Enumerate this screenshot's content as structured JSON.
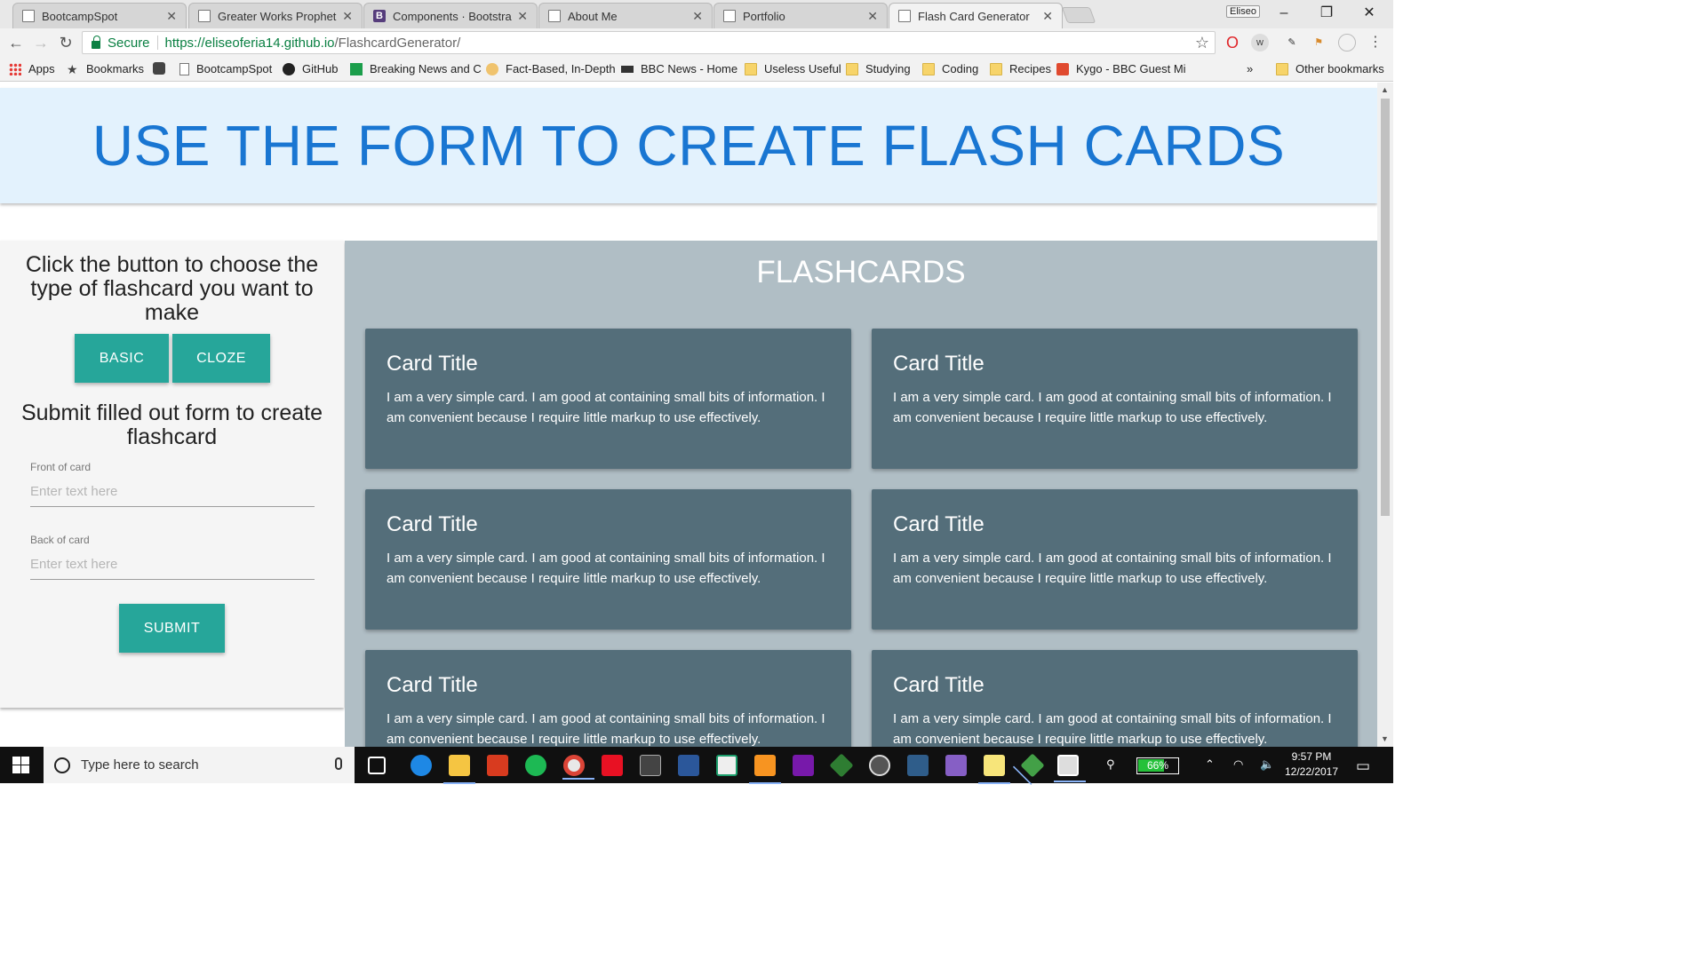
{
  "browser": {
    "tabs": [
      {
        "title": "BootcampSpot",
        "icon": "doc-icon"
      },
      {
        "title": "Greater Works Prophetic",
        "icon": "doc-icon"
      },
      {
        "title": "Components · Bootstrap",
        "icon": "bootstrap-icon"
      },
      {
        "title": "About Me",
        "icon": "doc-icon"
      },
      {
        "title": "Portfolio",
        "icon": "doc-icon"
      },
      {
        "title": "Flash Card Generator",
        "icon": "doc-icon",
        "active": true
      }
    ],
    "profile_name": "Eliseo",
    "address": {
      "secure_label": "Secure",
      "url_scheme_host": "https://eliseoferia14.github.io",
      "url_path": "/FlashcardGenerator/"
    },
    "bookmarks": [
      {
        "label": "Apps",
        "icon": "apps-icon"
      },
      {
        "label": "Bookmarks",
        "icon": "star-icon"
      },
      {
        "label": "",
        "icon": "sneaker-icon"
      },
      {
        "label": "BootcampSpot",
        "icon": "doc-icon"
      },
      {
        "label": "GitHub",
        "icon": "github-icon"
      },
      {
        "label": "Breaking News and C",
        "icon": "news-icon"
      },
      {
        "label": "Fact-Based, In-Depth",
        "icon": "flame-icon"
      },
      {
        "label": "BBC News - Home",
        "icon": "bbc-icon"
      },
      {
        "label": "Useless Useful",
        "icon": "folder-icon"
      },
      {
        "label": "Studying",
        "icon": "folder-icon"
      },
      {
        "label": "Coding",
        "icon": "folder-icon"
      },
      {
        "label": "Recipes",
        "icon": "folder-icon"
      },
      {
        "label": "Kygo - BBC Guest Mi",
        "icon": "soundcloud-icon"
      }
    ],
    "overflow_label": "»",
    "other_bookmarks": "Other bookmarks"
  },
  "page": {
    "header": "USE THE FORM TO CREATE FLASH CARDS",
    "left": {
      "instruction": "Click the button to choose the type of flashcard you want to make",
      "basic_button": "BASIC",
      "cloze_button": "CLOZE",
      "submit_instruction": "Submit filled out form to create flashcard",
      "front_label": "Front of card",
      "front_placeholder": "Enter text here",
      "back_label": "Back of card",
      "back_placeholder": "Enter text here",
      "submit_button": "SUBMIT"
    },
    "right": {
      "heading": "FLASHCARDS",
      "cards": [
        {
          "title": "Card Title",
          "body": "I am a very simple card. I am good at containing small bits of information. I am convenient because I require little markup to use effectively."
        },
        {
          "title": "Card Title",
          "body": "I am a very simple card. I am good at containing small bits of information. I am convenient because I require little markup to use effectively."
        },
        {
          "title": "Card Title",
          "body": "I am a very simple card. I am good at containing small bits of information. I am convenient because I require little markup to use effectively."
        },
        {
          "title": "Card Title",
          "body": "I am a very simple card. I am good at containing small bits of information. I am convenient because I require little markup to use effectively."
        },
        {
          "title": "Card Title",
          "body": "I am a very simple card. I am good at containing small bits of information. I am convenient because I require little markup to use effectively."
        },
        {
          "title": "Card Title",
          "body": "I am a very simple card. I am good at containing small bits of information. I am convenient because I require little markup to use effectively."
        }
      ]
    }
  },
  "taskbar": {
    "search_placeholder": "Type here to search",
    "battery_percent": "66%",
    "battery_level": 0.66,
    "time": "9:57 PM",
    "date": "12/22/2017"
  },
  "colors": {
    "header_bg": "#e3f2fd",
    "header_text": "#1976d2",
    "button_teal": "#26a69a",
    "right_panel_bg": "#b0bec5",
    "card_bg": "#546e7a"
  }
}
